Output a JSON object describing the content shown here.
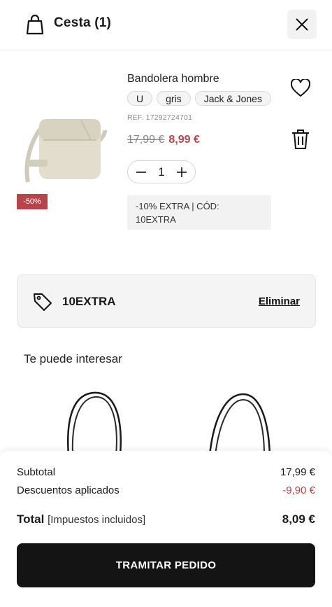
{
  "header": {
    "title": "Cesta (1)"
  },
  "product": {
    "name": "Bandolera hombre",
    "tags": [
      "U",
      "gris",
      "Jack & Jones"
    ],
    "ref": "REF. 17292724701",
    "price_old": "17,99 €",
    "price_new": "8,99 €",
    "discount_badge": "-50%",
    "quantity": "1",
    "promo_line1": "-10% EXTRA | CÓD:",
    "promo_line2": "10EXTRA"
  },
  "coupon": {
    "code": "10EXTRA",
    "remove_label": "Eliminar"
  },
  "recommendations": {
    "title": "Te puede interesar"
  },
  "summary": {
    "subtotal_label": "Subtotal",
    "subtotal_value": "17,99 €",
    "discount_label": "Descuentos aplicados",
    "discount_value": "-9,90 €",
    "total_label": "Total",
    "total_note": "[Impuestos incluidos]",
    "total_value": "8,09 €",
    "checkout_label": "TRAMITAR PEDIDO"
  },
  "colors": {
    "accent_red": "#b5454b",
    "button_dark": "#141414"
  }
}
